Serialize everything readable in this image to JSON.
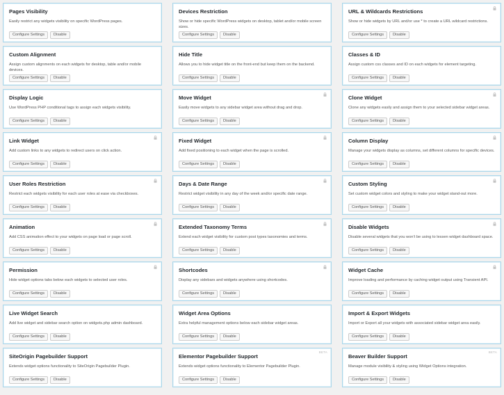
{
  "buttons": {
    "configure": "Configure Settings",
    "disable": "Disable"
  },
  "cards": [
    {
      "title": "Pages Visibility",
      "desc": "Easily restrict any widgets visibility on specific WordPress pages.",
      "locked": false,
      "tag": ""
    },
    {
      "title": "Devices Restriction",
      "desc": "Show or hide specific WordPress widgets on desktop, tablet and/or mobile screen sizes.",
      "locked": false,
      "tag": ""
    },
    {
      "title": "URL & Wildcards Restrictions",
      "desc": "Show or hide widgets by URL and/or use * to create a URL wildcard restrictions.",
      "locked": true,
      "tag": ""
    },
    {
      "title": "Custom Alignment",
      "desc": "Assign custom alignments on each widgets for desktop, table and/or mobile devices.",
      "locked": false,
      "tag": ""
    },
    {
      "title": "Hide Title",
      "desc": "Allows you to hide widget title on the front-end but keep them on the backend.",
      "locked": false,
      "tag": ""
    },
    {
      "title": "Classes & ID",
      "desc": "Assign custom css classes and ID on each widgets for element targeting.",
      "locked": false,
      "tag": ""
    },
    {
      "title": "Display Logic",
      "desc": "Use WordPress PHP conditional tags to assign each widgets visibility.",
      "locked": false,
      "tag": ""
    },
    {
      "title": "Move Widget",
      "desc": "Easily move widgets to any sidebar widget area without drag and drop.",
      "locked": true,
      "tag": ""
    },
    {
      "title": "Clone Widget",
      "desc": "Clone any widgets easily and assign them to your selected sidebar widget areas.",
      "locked": true,
      "tag": ""
    },
    {
      "title": "Link Widget",
      "desc": "Add custom links to any widgets to redirect users on click action.",
      "locked": true,
      "tag": ""
    },
    {
      "title": "Fixed Widget",
      "desc": "Add fixed positioning to each widget when the page is scrolled.",
      "locked": true,
      "tag": ""
    },
    {
      "title": "Column Display",
      "desc": "Manage your widgets display as columns, set different columns for specific devices.",
      "locked": true,
      "tag": ""
    },
    {
      "title": "User Roles Restriction",
      "desc": "Restrict each widgets visibility for each user roles at ease via checkboxes.",
      "locked": true,
      "tag": ""
    },
    {
      "title": "Days & Date Range",
      "desc": "Restrict widget visibility in any day of the week and/or specific date range.",
      "locked": true,
      "tag": ""
    },
    {
      "title": "Custom Styling",
      "desc": "Set custom widget colors and styling to make your widget stand-out more.",
      "locked": true,
      "tag": ""
    },
    {
      "title": "Animation",
      "desc": "Add CSS animation effect to your widgets on page load or page scroll.",
      "locked": true,
      "tag": ""
    },
    {
      "title": "Extended Taxonomy Terms",
      "desc": "Extend each widget visibility for custom post types taxonomies and terms.",
      "locked": true,
      "tag": ""
    },
    {
      "title": "Disable Widgets",
      "desc": "Disable several widgets that you won't be using to lessen widget dashboard space.",
      "locked": true,
      "tag": ""
    },
    {
      "title": "Permission",
      "desc": "Hide widget options tabs below each widgets to selected user roles.",
      "locked": true,
      "tag": ""
    },
    {
      "title": "Shortcodes",
      "desc": "Display any sidebars and widgets anywhere using shortcodes.",
      "locked": true,
      "tag": ""
    },
    {
      "title": "Widget Cache",
      "desc": "Improve loading and performance by caching widget output using Transient API.",
      "locked": true,
      "tag": ""
    },
    {
      "title": "Live Widget Search",
      "desc": "Add live widget and sidebar search option on widgets.php admin dashboard.",
      "locked": false,
      "tag": ""
    },
    {
      "title": "Widget Area Options",
      "desc": "Extra helpful management options below each sidebar widget areas.",
      "locked": false,
      "tag": ""
    },
    {
      "title": "Import & Export Widgets",
      "desc": "Import or Export all your widgets with associated sidebar widget area easily.",
      "locked": false,
      "tag": ""
    },
    {
      "title": "SiteOrigin Pagebuilder Support",
      "desc": "Extends widget options functionality to SiteOrigin Pagebuilder Plugin.",
      "locked": false,
      "tag": ""
    },
    {
      "title": "Elementor Pagebuilder Support",
      "desc": "Extends widget options functionality to Elementor Pagebuilder Plugin.",
      "locked": false,
      "tag": "BETA"
    },
    {
      "title": "Beaver Builder Support",
      "desc": "Manage module visibility & styling using Widget Options integration.",
      "locked": false,
      "tag": "BETA"
    }
  ],
  "colors": {
    "card_border": "#a9d6ea",
    "page_bg": "#f1f1f1",
    "title": "#23282d"
  },
  "icons": {
    "lock": "lock-icon"
  }
}
